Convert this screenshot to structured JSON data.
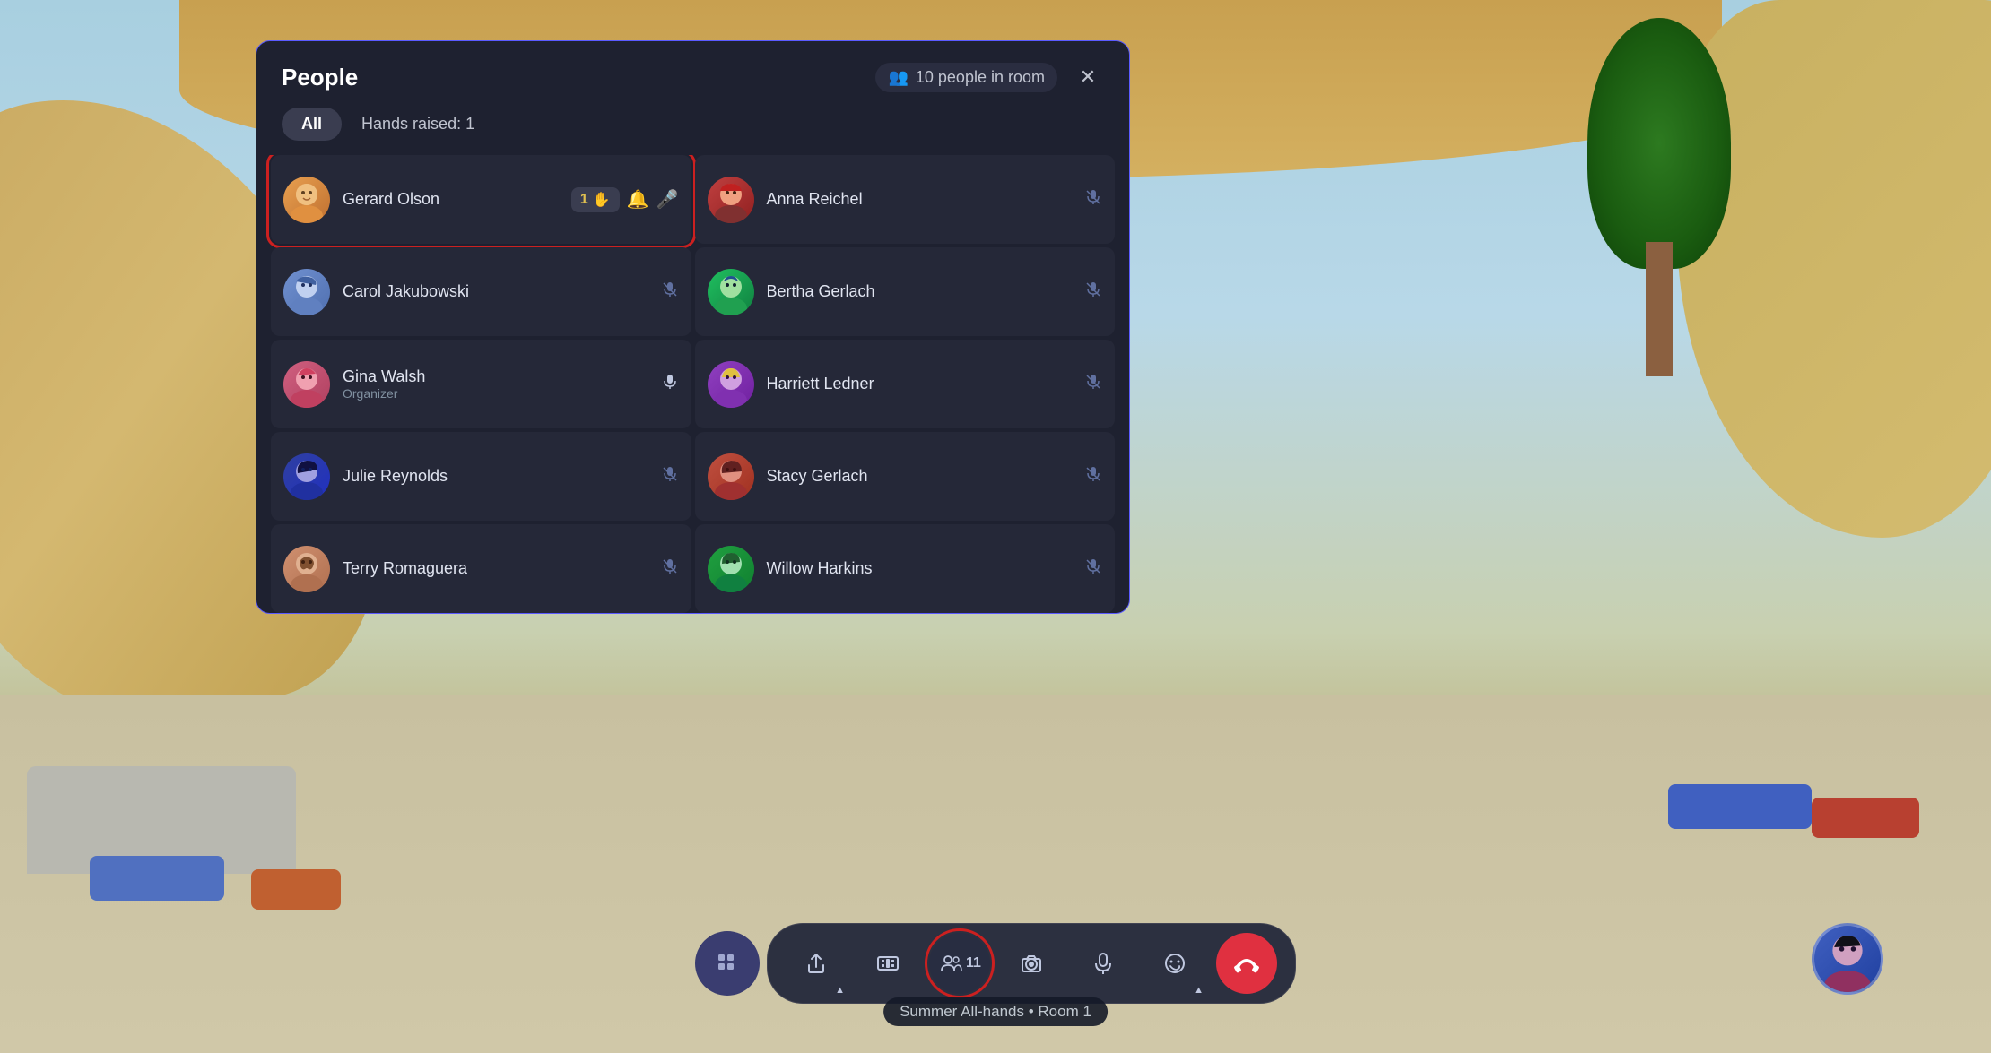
{
  "background": {
    "color": "#7aafcd"
  },
  "panel": {
    "title": "People",
    "people_count": "10 people in room",
    "filters": {
      "all_label": "All",
      "hands_raised_label": "Hands raised: 1"
    },
    "people": [
      {
        "id": "gerard",
        "name": "Gerard Olson",
        "role": "",
        "hand_raised": true,
        "hand_count": "1",
        "mic_active": true,
        "muted": false,
        "avatar_class": "av-gerard",
        "avatar_emoji": "🧑"
      },
      {
        "id": "anna",
        "name": "Anna Reichel",
        "role": "",
        "hand_raised": false,
        "mic_active": false,
        "muted": true,
        "avatar_class": "av-anna",
        "avatar_emoji": "👩"
      },
      {
        "id": "carol",
        "name": "Carol Jakubowski",
        "role": "",
        "hand_raised": false,
        "mic_active": false,
        "muted": true,
        "avatar_class": "av-carol",
        "avatar_emoji": "👩"
      },
      {
        "id": "bertha",
        "name": "Bertha Gerlach",
        "role": "",
        "hand_raised": false,
        "mic_active": false,
        "muted": true,
        "avatar_class": "av-bertha",
        "avatar_emoji": "👩"
      },
      {
        "id": "gina",
        "name": "Gina Walsh",
        "role": "Organizer",
        "hand_raised": false,
        "mic_active": true,
        "muted": false,
        "avatar_class": "av-gina",
        "avatar_emoji": "👩"
      },
      {
        "id": "harriett",
        "name": "Harriett Ledner",
        "role": "",
        "hand_raised": false,
        "mic_active": false,
        "muted": true,
        "avatar_class": "av-harriett",
        "avatar_emoji": "👩"
      },
      {
        "id": "julie",
        "name": "Julie Reynolds",
        "role": "",
        "hand_raised": false,
        "mic_active": false,
        "muted": true,
        "avatar_class": "av-julie",
        "avatar_emoji": "👩"
      },
      {
        "id": "stacy",
        "name": "Stacy Gerlach",
        "role": "",
        "hand_raised": false,
        "mic_active": false,
        "muted": true,
        "avatar_class": "av-stacy",
        "avatar_emoji": "👩"
      },
      {
        "id": "terry",
        "name": "Terry Romaguera",
        "role": "",
        "hand_raised": false,
        "mic_active": false,
        "muted": true,
        "avatar_class": "av-terry",
        "avatar_emoji": "🧔"
      },
      {
        "id": "willow",
        "name": "Willow Harkins",
        "role": "",
        "hand_raised": false,
        "mic_active": false,
        "muted": true,
        "avatar_class": "av-willow",
        "avatar_emoji": "👩"
      }
    ]
  },
  "toolbar": {
    "grid_icon": "⊞",
    "share_label": "share",
    "film_label": "film",
    "people_label": "people",
    "people_count": "11",
    "camera_label": "camera",
    "mic_label": "mic",
    "emoji_label": "emoji",
    "end_label": "end",
    "end_icon": "☎"
  },
  "room_label": "Summer All-hands • Room 1",
  "user_avatar": {
    "emoji": "👩"
  }
}
